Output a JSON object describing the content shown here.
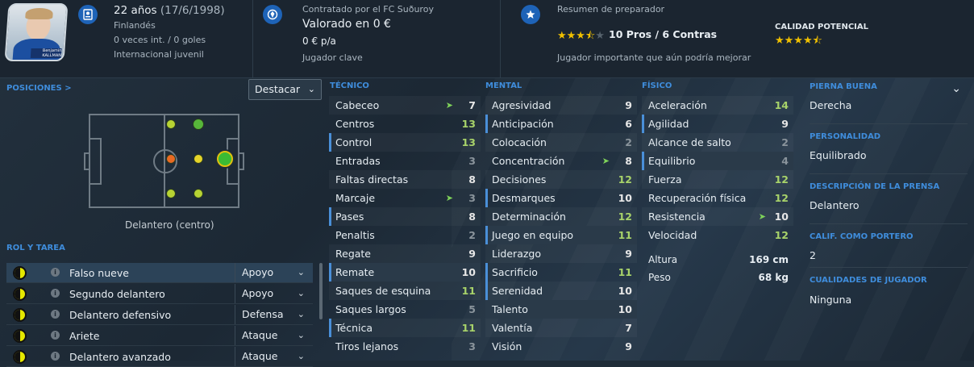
{
  "header": {
    "age": "22 años",
    "dob": "(17/6/1998)",
    "nationality": "Finlandés",
    "intl": "0 veces int. / 0 goles",
    "intl_status": "Internacional juvenil",
    "photo_caption": "Benjamin KALLMAN",
    "contract": "Contratado por el FC Suðuroy",
    "value": "Valorado en 0 €",
    "wage": "0 € p/a",
    "squad_status": "Jugador clave",
    "coach_report_title": "Resumen de preparador",
    "current_stars": 3.5,
    "pros_cons": "10 Pros / 6 Contras",
    "coach_summary": "Jugador importante que aún podría mejorar",
    "potential_label": "CALIDAD POTENCIAL",
    "potential_stars": 4.5
  },
  "positions": {
    "label": "POSICIONES >",
    "highlight_button": "Destacar",
    "role_label": "Delantero (centro)"
  },
  "roles": {
    "label": "ROL Y TAREA",
    "items": [
      {
        "name": "Falso nueve",
        "duty": "Apoyo"
      },
      {
        "name": "Segundo delantero",
        "duty": "Apoyo"
      },
      {
        "name": "Delantero defensivo",
        "duty": "Defensa"
      },
      {
        "name": "Ariete",
        "duty": "Ataque"
      },
      {
        "name": "Delantero avanzado",
        "duty": "Ataque"
      }
    ]
  },
  "technical": {
    "label": "TÉCNICO",
    "items": [
      {
        "name": "Cabeceo",
        "value": "7"
      },
      {
        "name": "Centros",
        "value": "13"
      },
      {
        "name": "Control",
        "value": "13"
      },
      {
        "name": "Entradas",
        "value": "3"
      },
      {
        "name": "Faltas directas",
        "value": "8"
      },
      {
        "name": "Marcaje",
        "value": "3"
      },
      {
        "name": "Pases",
        "value": "8"
      },
      {
        "name": "Penaltis",
        "value": "2"
      },
      {
        "name": "Regate",
        "value": "9"
      },
      {
        "name": "Remate",
        "value": "10"
      },
      {
        "name": "Saques de esquina",
        "value": "11"
      },
      {
        "name": "Saques largos",
        "value": "5"
      },
      {
        "name": "Técnica",
        "value": "11"
      },
      {
        "name": "Tiros lejanos",
        "value": "3"
      }
    ]
  },
  "mental": {
    "label": "MENTAL",
    "items": [
      {
        "name": "Agresividad",
        "value": "9"
      },
      {
        "name": "Anticipación",
        "value": "6"
      },
      {
        "name": "Colocación",
        "value": "2"
      },
      {
        "name": "Concentración",
        "value": "8"
      },
      {
        "name": "Decisiones",
        "value": "12"
      },
      {
        "name": "Desmarques",
        "value": "10"
      },
      {
        "name": "Determinación",
        "value": "12"
      },
      {
        "name": "Juego en equipo",
        "value": "11"
      },
      {
        "name": "Liderazgo",
        "value": "9"
      },
      {
        "name": "Sacrificio",
        "value": "11"
      },
      {
        "name": "Serenidad",
        "value": "10"
      },
      {
        "name": "Talento",
        "value": "10"
      },
      {
        "name": "Valentía",
        "value": "7"
      },
      {
        "name": "Visión",
        "value": "9"
      }
    ]
  },
  "physical": {
    "label": "FÍSICO",
    "items": [
      {
        "name": "Aceleración",
        "value": "14"
      },
      {
        "name": "Agilidad",
        "value": "9"
      },
      {
        "name": "Alcance de salto",
        "value": "2"
      },
      {
        "name": "Equilibrio",
        "value": "4"
      },
      {
        "name": "Fuerza",
        "value": "12"
      },
      {
        "name": "Recuperación física",
        "value": "12"
      },
      {
        "name": "Resistencia",
        "value": "10"
      },
      {
        "name": "Velocidad",
        "value": "12"
      }
    ],
    "height_label": "Altura",
    "height": "169 cm",
    "weight_label": "Peso",
    "weight": "68 kg"
  },
  "profile": {
    "foot_label": "PIERNA BUENA",
    "foot": "Derecha",
    "personality_label": "PERSONALIDAD",
    "personality": "Equilibrado",
    "media_label": "DESCRIPCIÓN DE LA PRENSA",
    "media": "Delantero",
    "gk_label": "CALIF. COMO PORTERO",
    "gk": "2",
    "traits_label": "CUALIDADES DE JUGADOR",
    "traits": "Ninguna"
  },
  "colors": {
    "accent": "#3f8ddc",
    "good": "#a8d36a",
    "icon_bg": "#1e63b7"
  }
}
